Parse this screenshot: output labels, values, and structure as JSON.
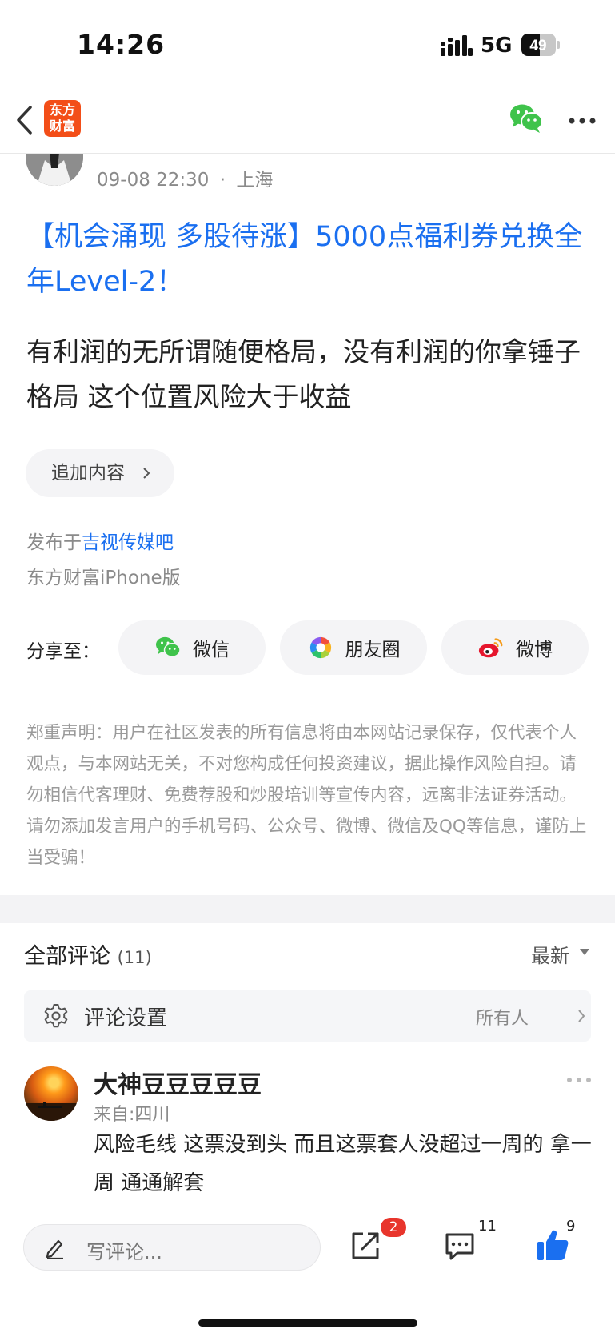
{
  "status_bar": {
    "time": "14:26",
    "network": "5G",
    "battery": "49"
  },
  "nav": {
    "logo_text_line1": "东方",
    "logo_text_line2": "财富"
  },
  "post": {
    "date": "09-08 22:30",
    "location": "上海",
    "meta_separator": "·",
    "title": "【机会涌现 多股待涨】5000点福利券兑换全年Level-2！",
    "body": "有利润的无所谓随便格局，没有利润的你拿锤子格局 这个位置风险大于收益",
    "append_label": "追加内容",
    "posted_in_prefix": "发布于",
    "bar_name": "吉视传媒吧",
    "client": "东方财富iPhone版"
  },
  "share": {
    "label": "分享至：",
    "wechat": "微信",
    "moments": "朋友圈",
    "weibo": "微博"
  },
  "disclaimer": "郑重声明：用户在社区发表的所有信息将由本网站记录保存，仅代表个人观点，与本网站无关，不对您构成任何投资建议，据此操作风险自担。请勿相信代客理财、免费荐股和炒股培训等宣传内容，远离非法证券活动。请勿添加发言用户的手机号码、公众号、微博、微信及QQ等信息，谨防上当受骗！",
  "comments": {
    "title": "全部评论",
    "count": "(11)",
    "sort": "最新",
    "setting_label": "评论设置",
    "setting_value": "所有人",
    "items": [
      {
        "name": "大神豆豆豆豆豆",
        "from": "来自:四川",
        "text": "风险毛线 这票没到头 而且这票套人没超过一周的 拿一周 通通解套"
      }
    ]
  },
  "bottom_bar": {
    "write_placeholder": "写评论...",
    "share_badge": "2",
    "comment_count": "11",
    "like_count": "9"
  },
  "colors": {
    "accent_blue": "#1a6ff0",
    "brand_orange": "#f34e18",
    "badge_red": "#e8352c",
    "wechat_green": "#3fc34b"
  }
}
